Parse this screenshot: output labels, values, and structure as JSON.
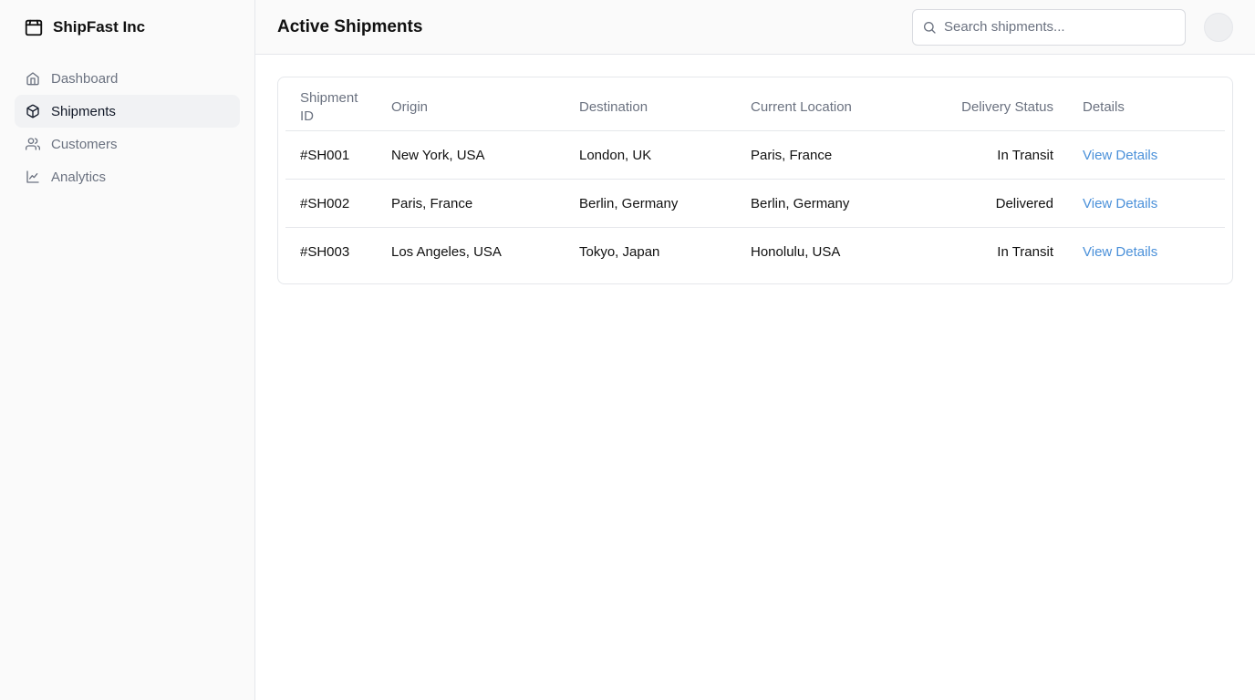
{
  "brand": {
    "name": "ShipFast Inc",
    "icon": "package-box-icon"
  },
  "sidebar": {
    "items": [
      {
        "label": "Dashboard",
        "icon": "home-icon",
        "active": false
      },
      {
        "label": "Shipments",
        "icon": "package-icon",
        "active": true
      },
      {
        "label": "Customers",
        "icon": "users-icon",
        "active": false
      },
      {
        "label": "Analytics",
        "icon": "line-chart-icon",
        "active": false
      }
    ]
  },
  "header": {
    "title": "Active Shipments",
    "search_placeholder": "Search shipments..."
  },
  "table": {
    "columns": [
      "Shipment ID",
      "Origin",
      "Destination",
      "Current Location",
      "Delivery Status",
      "Details"
    ],
    "rows": [
      {
        "id": "#SH001",
        "origin": "New York, USA",
        "destination": "London, UK",
        "current": "Paris, France",
        "status": "In Transit",
        "details": "View Details"
      },
      {
        "id": "#SH002",
        "origin": "Paris, France",
        "destination": "Berlin, Germany",
        "current": "Berlin, Germany",
        "status": "Delivered",
        "details": "View Details"
      },
      {
        "id": "#SH003",
        "origin": "Los Angeles, USA",
        "destination": "Tokyo, Japan",
        "current": "Honolulu, USA",
        "status": "In Transit",
        "details": "View Details"
      }
    ]
  },
  "colors": {
    "link": "#4a90d9",
    "active_bg": "#f1f2f4",
    "muted_text": "#6b7280"
  }
}
